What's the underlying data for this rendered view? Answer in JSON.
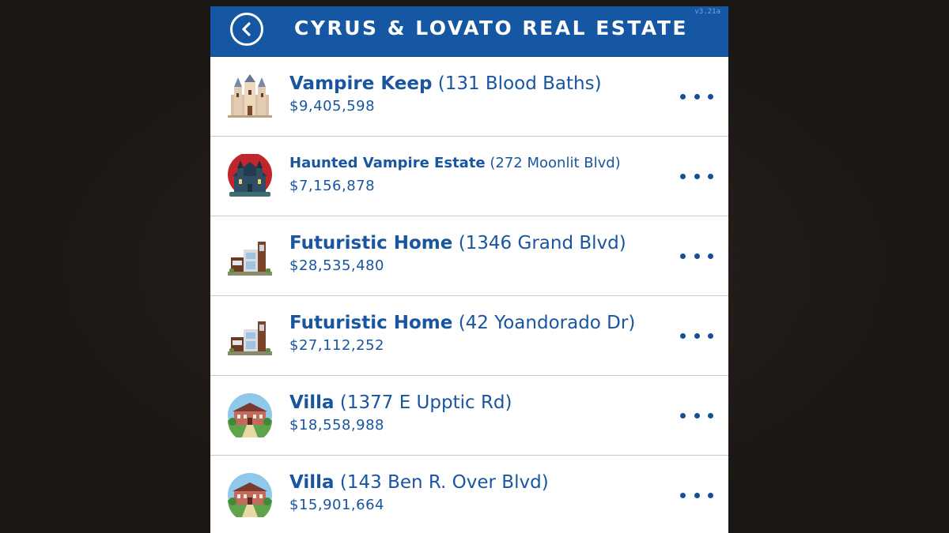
{
  "header": {
    "title": "CYRUS & LOVATO REAL ESTATE",
    "version": "v3.21a",
    "back_icon": "chevron-left-icon",
    "color": "#1557a3"
  },
  "listings": [
    {
      "name": "Vampire Keep",
      "address": "(131 Blood Baths)",
      "price": "$9,405,598",
      "icon": "castle-icon"
    },
    {
      "name": "Haunted Vampire Estate",
      "address": "(272 Moonlit Blvd)",
      "price": "$7,156,878",
      "icon": "haunted-mansion-icon"
    },
    {
      "name": "Futuristic Home",
      "address": "(1346 Grand Blvd)",
      "price": "$28,535,480",
      "icon": "modern-house-icon"
    },
    {
      "name": "Futuristic Home",
      "address": "(42 Yoandorado Dr)",
      "price": "$27,112,252",
      "icon": "modern-house-icon"
    },
    {
      "name": "Villa",
      "address": "(1377 E Upptic Rd)",
      "price": "$18,558,988",
      "icon": "villa-icon"
    },
    {
      "name": "Villa",
      "address": "(143 Ben R. Over Blvd)",
      "price": "$15,901,664",
      "icon": "villa-icon"
    }
  ],
  "more_icon": "more-dots-icon",
  "text_color": "#1a55a0"
}
